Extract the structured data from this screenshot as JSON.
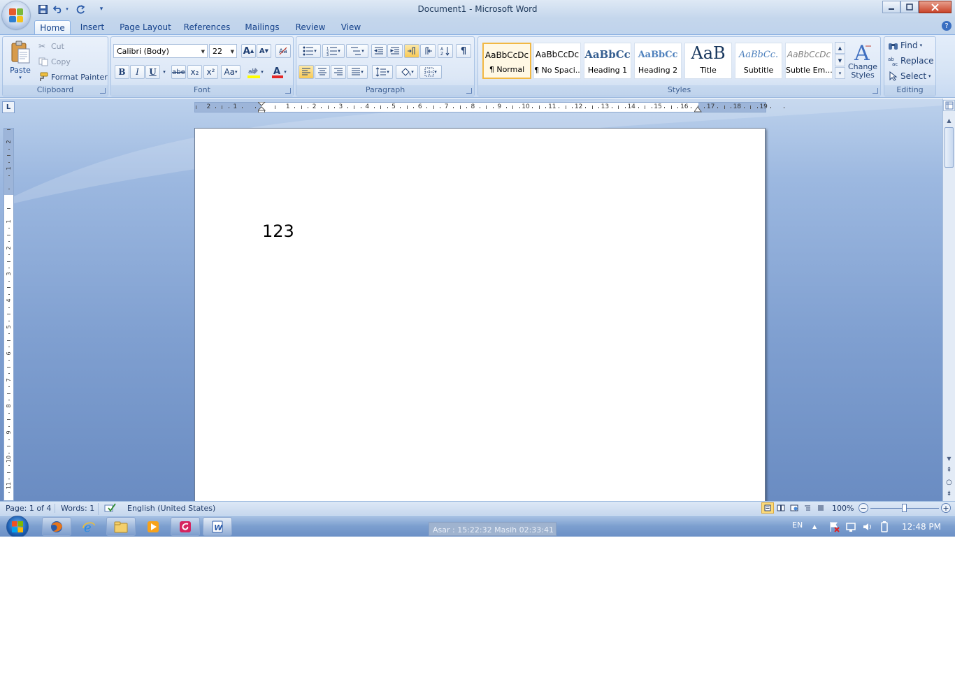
{
  "window": {
    "title": "Document1 - Microsoft Word",
    "controls": [
      "minimize",
      "maximize",
      "close"
    ]
  },
  "quick_access": [
    "save-icon",
    "undo-icon",
    "redo-icon",
    "customize-icon"
  ],
  "tabs": [
    "Home",
    "Insert",
    "Page Layout",
    "References",
    "Mailings",
    "Review",
    "View"
  ],
  "active_tab": "Home",
  "ribbon": {
    "clipboard": {
      "label": "Clipboard",
      "paste": "Paste",
      "cut": "Cut",
      "copy": "Copy",
      "format_painter": "Format Painter"
    },
    "font": {
      "label": "Font",
      "font_name": "Calibri (Body)",
      "font_size": "22",
      "bold": "B",
      "italic": "I",
      "underline": "U",
      "strike": "abe",
      "subscript": "x₂",
      "superscript": "x²",
      "change_case": "Aa",
      "grow": "A",
      "shrink": "A"
    },
    "paragraph": {
      "label": "Paragraph"
    },
    "styles": {
      "label": "Styles",
      "items": [
        {
          "preview": "AaBbCcDc",
          "name": "¶ Normal"
        },
        {
          "preview": "AaBbCcDc",
          "name": "¶ No Spaci..."
        },
        {
          "preview": "AaBbCc",
          "name": "Heading 1"
        },
        {
          "preview": "AaBbCc",
          "name": "Heading 2"
        },
        {
          "preview": "AaB",
          "name": "Title"
        },
        {
          "preview": "AaBbCc.",
          "name": "Subtitle"
        },
        {
          "preview": "AaBbCcDc",
          "name": "Subtle Em..."
        }
      ],
      "change_styles": "Change Styles"
    },
    "editing": {
      "label": "Editing",
      "find": "Find",
      "replace": "Replace",
      "select": "Select"
    }
  },
  "ruler": {
    "h_ticks": [
      "2",
      "1",
      "1",
      "2",
      "3",
      "4",
      "5",
      "6",
      "7",
      "8",
      "9",
      "10",
      "11",
      "12",
      "13",
      "14",
      "15",
      "16",
      "17",
      "18",
      "19"
    ],
    "v_ticks": [
      "2",
      "1",
      "1",
      "2",
      "3",
      "4",
      "5",
      "6",
      "7",
      "8",
      "9",
      "10",
      "11"
    ],
    "corner": "L"
  },
  "document": {
    "content": "123"
  },
  "status": {
    "page": "Page: 1 of 4",
    "words": "Words: 1",
    "language": "English (United States)",
    "zoom": "100%"
  },
  "taskbar": {
    "apps": [
      "firefox-icon",
      "internet-explorer-icon",
      "explorer-icon",
      "media-player-icon",
      "app-icon",
      "word-icon"
    ],
    "prayer_times": "Asar : 15:22:32  Masih 02:33:41",
    "lang": "EN",
    "clock": "12:48 PM"
  }
}
